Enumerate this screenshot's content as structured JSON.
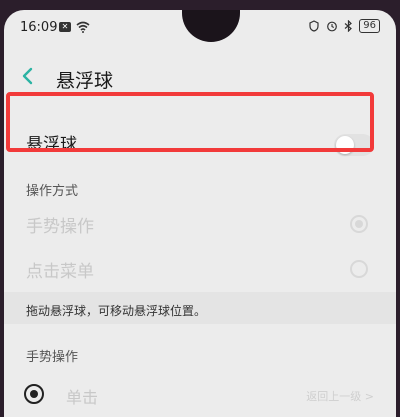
{
  "status_bar": {
    "time": "16:09",
    "notification_badge": "✕",
    "battery": "96"
  },
  "header": {
    "title": "悬浮球"
  },
  "main_toggle": {
    "label": "悬浮球",
    "enabled": false
  },
  "operation_mode": {
    "section_title": "操作方式",
    "options": [
      {
        "label": "手势操作",
        "selected": true
      },
      {
        "label": "点击菜单",
        "selected": false
      }
    ]
  },
  "hint": {
    "text": "拖动悬浮球，可移动悬浮球位置。"
  },
  "gesture_section": {
    "title": "手势操作",
    "rows": [
      {
        "label": "单击",
        "value": "返回上一级 >"
      }
    ]
  },
  "colors": {
    "highlight_border": "#f23a3a",
    "accent_back": "#2bb3a3"
  }
}
